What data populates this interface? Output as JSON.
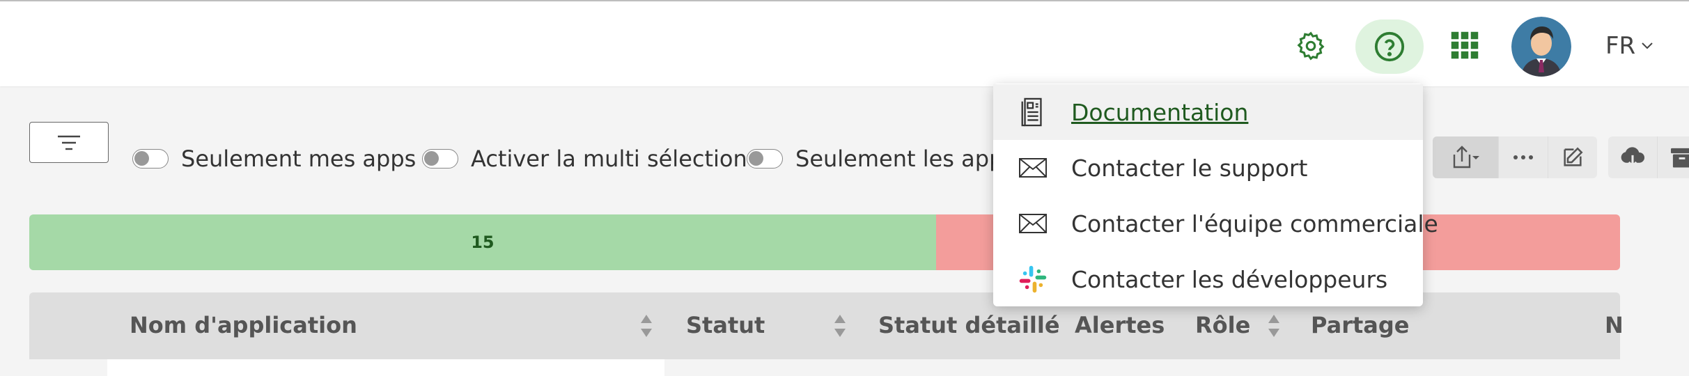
{
  "header": {
    "language": "FR"
  },
  "filters": {
    "toggles": [
      {
        "label": "Seulement mes apps"
      },
      {
        "label": "Activer la multi sélection"
      },
      {
        "label": "Seulement les apps"
      }
    ]
  },
  "summary_bar": {
    "green_count": "15",
    "green_fraction": 0.57
  },
  "table": {
    "columns": [
      {
        "label": "Nom d'application",
        "sortable": true
      },
      {
        "label": "Statut",
        "sortable": true
      },
      {
        "label": "Statut détaillé",
        "sortable": false
      },
      {
        "label": "Alertes",
        "sortable": false
      },
      {
        "label": "Rôle",
        "sortable": true
      },
      {
        "label": "Partage",
        "sortable": false
      },
      {
        "label": "N",
        "sortable": false
      }
    ]
  },
  "help_menu": {
    "items": [
      {
        "label": "Documentation",
        "icon": "document-icon",
        "selected": true
      },
      {
        "label": "Contacter le support",
        "icon": "mail-icon",
        "selected": false
      },
      {
        "label": "Contacter l'équipe commerciale",
        "icon": "mail-icon",
        "selected": false
      },
      {
        "label": "Contacter les développeurs",
        "icon": "slack-icon",
        "selected": false
      }
    ]
  },
  "colors": {
    "accent": "#2e7d32",
    "help_bg": "#dff3df",
    "green_segment": "#a5d9a7",
    "red_segment": "#f39d9b"
  }
}
